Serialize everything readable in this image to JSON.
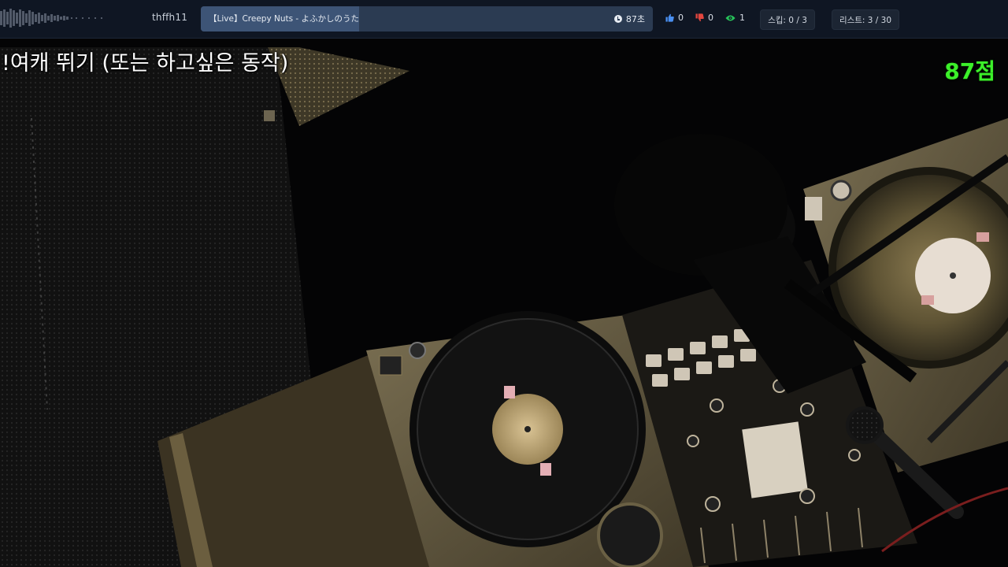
{
  "topbar": {
    "username": "thffh11",
    "song": {
      "title": "【Live】Creepy Nuts - よふかしのうた",
      "time_left": "87초",
      "progress_fraction": 0.35
    },
    "likes": "0",
    "dislikes": "0",
    "viewers": "1",
    "skip": "스킵: 0 / 3",
    "list": "리스트: 3 / 30"
  },
  "overlay": {
    "command_text": "!여캐 뛰기 (또는 하고싶은 동작)",
    "score": "87점"
  },
  "colors": {
    "topbar_bg": "#0f1623",
    "song_bar": "#2b3b52",
    "song_progress": "#3d5476",
    "like": "#4a8ff0",
    "dislike": "#e2463f",
    "viewer": "#27c35a",
    "score": "#3cf02a"
  },
  "icons": {
    "clock": "clock-icon",
    "like": "thumbs-up-icon",
    "dislike": "thumbs-down-icon",
    "viewers": "eye-icon"
  }
}
